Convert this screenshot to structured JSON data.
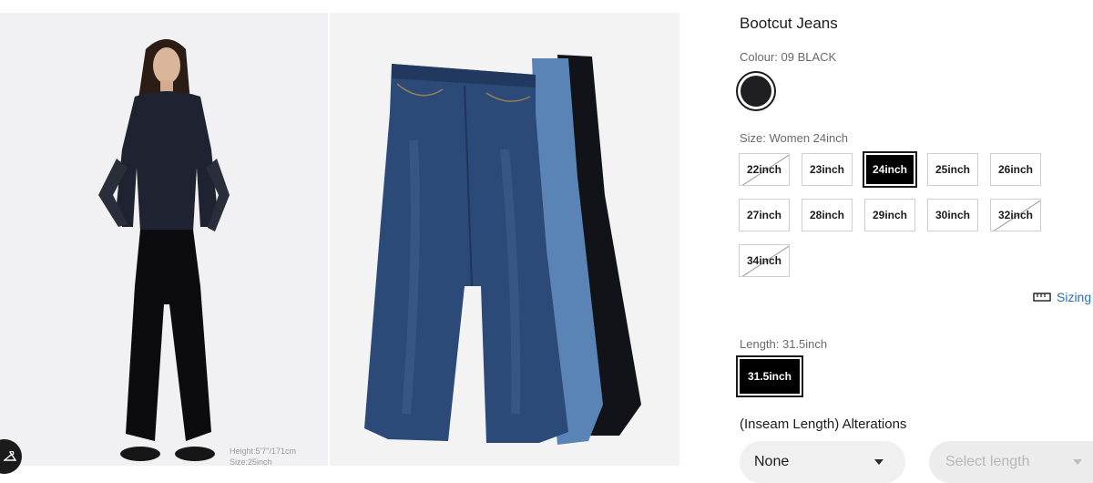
{
  "product": {
    "title": "Bootcut Jeans"
  },
  "colour": {
    "label": "Colour: 09 BLACK",
    "swatch_color": "#1f1f22"
  },
  "size": {
    "label": "Size: Women 24inch",
    "options": [
      {
        "label": "22inch",
        "available": false,
        "selected": false
      },
      {
        "label": "23inch",
        "available": true,
        "selected": false
      },
      {
        "label": "24inch",
        "available": true,
        "selected": true
      },
      {
        "label": "25inch",
        "available": true,
        "selected": false
      },
      {
        "label": "26inch",
        "available": true,
        "selected": false
      },
      {
        "label": "27inch",
        "available": true,
        "selected": false
      },
      {
        "label": "28inch",
        "available": true,
        "selected": false
      },
      {
        "label": "29inch",
        "available": true,
        "selected": false
      },
      {
        "label": "30inch",
        "available": true,
        "selected": false
      },
      {
        "label": "32inch",
        "available": false,
        "selected": false
      },
      {
        "label": "34inch",
        "available": false,
        "selected": false
      }
    ]
  },
  "sizing_link": {
    "label": "Sizing",
    "icon": "ruler-icon"
  },
  "length": {
    "label": "Length: 31.5inch",
    "option": "31.5inch"
  },
  "alterations": {
    "title": "(Inseam Length) Alterations",
    "dropdown_value": "None",
    "length_placeholder": "Select length"
  },
  "gallery": {
    "caption_line1": "Height:5'7\"/171cm",
    "caption_line2": "Size:25inch",
    "hanger_icon": "hanger-icon"
  },
  "colors": {
    "selected_bg": "#000000",
    "link": "#2a6fb0",
    "dropdown_bg": "#f0f0f0"
  }
}
